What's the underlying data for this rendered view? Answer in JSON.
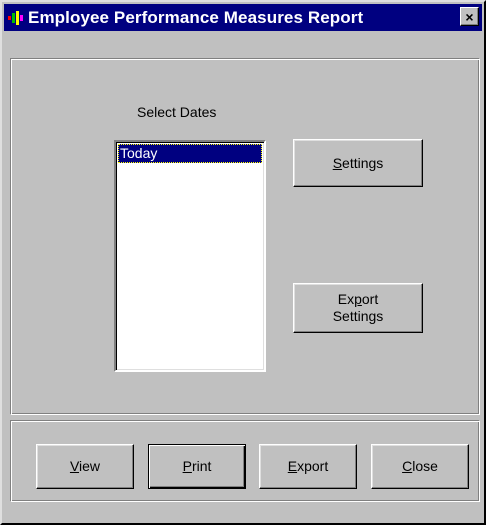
{
  "window": {
    "title": "Employee Performance Measures Report",
    "close_glyph": "×",
    "app_icon": "report-app-icon"
  },
  "dates": {
    "label": "Select Dates",
    "items": [
      "Today"
    ],
    "selected_index": 0
  },
  "side_buttons": {
    "settings": {
      "pre": "",
      "key": "S",
      "post": "ettings"
    },
    "export_settings": {
      "line1_pre": "Ex",
      "line1_key": "p",
      "line1_post": "ort",
      "line2": "Settings"
    }
  },
  "actions": {
    "view": {
      "key": "V",
      "post": "iew"
    },
    "print": {
      "key": "P",
      "post": "rint"
    },
    "export": {
      "key": "E",
      "post": "xport"
    },
    "close": {
      "key": "C",
      "post": "lose"
    }
  },
  "colors": {
    "titlebar": "#000080",
    "face": "#c0c0c0",
    "selection": "#000080"
  }
}
